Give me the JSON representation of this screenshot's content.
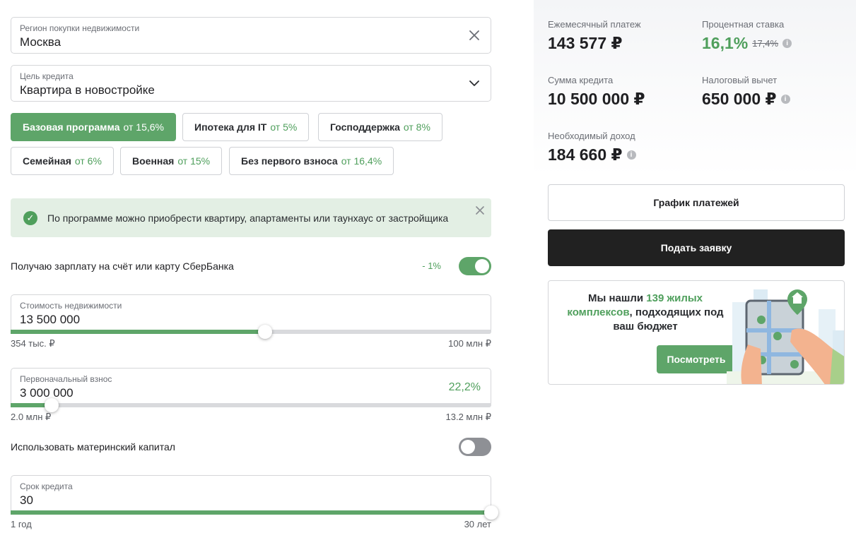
{
  "region": {
    "label": "Регион покупки недвижимости",
    "value": "Москва",
    "clear_icon": "close-icon"
  },
  "purpose": {
    "label": "Цель кредита",
    "value": "Квартира в новостройке",
    "dropdown_icon": "chevron-down-icon"
  },
  "programs": [
    {
      "name": "Базовая программа",
      "from": "от 15,6%",
      "active": true
    },
    {
      "name": "Ипотека для IT",
      "from": "от 5%",
      "active": false
    },
    {
      "name": "Господдержка",
      "from": "от 8%",
      "active": false
    },
    {
      "name": "Семейная",
      "from": "от 6%",
      "active": false
    },
    {
      "name": "Военная",
      "from": "от 15%",
      "active": false
    },
    {
      "name": "Без первого взноса",
      "from": "от 16,4%",
      "active": false
    }
  ],
  "notice": {
    "text": "По программе можно приобрести квартиру, апартаменты или таунхаус от застройщика"
  },
  "salary": {
    "label": "Получаю зарплату на счёт или карту СберБанка",
    "discount": "- 1%",
    "enabled": true
  },
  "property_cost": {
    "label": "Стоимость недвижимости",
    "value": "13 500 000",
    "min": "354 тыс. ₽",
    "max": "100 млн ₽",
    "fill_fraction": 0.53
  },
  "down_payment": {
    "label": "Первоначальный взнос",
    "value": "3 000 000",
    "percent": "22,2%",
    "min": "2.0 млн ₽",
    "max": "13.2 млн ₽",
    "fill_fraction": 0.085
  },
  "maternity": {
    "label": "Использовать материнский капитал",
    "enabled": false
  },
  "term": {
    "label": "Срок кредита",
    "value": "30",
    "min": "1 год",
    "max": "30 лет",
    "fill_fraction": 1.0
  },
  "summary": {
    "monthly_label": "Ежемесячный платеж",
    "monthly_value": "143 577 ₽",
    "rate_label": "Процентная ставка",
    "rate_value": "16,1%",
    "rate_old": "17,4%",
    "loan_label": "Сумма кредита",
    "loan_value": "10 500 000 ₽",
    "tax_label": "Налоговый вычет",
    "tax_value": "650 000 ₽",
    "income_label": "Необходимый доход",
    "income_value": "184 660 ₽",
    "info_glyph": "i"
  },
  "buttons": {
    "schedule": "График платежей",
    "apply": "Подать заявку"
  },
  "promo": {
    "text_before": "Мы нашли ",
    "text_highlight": "139 жилых комплексов",
    "text_after": ", подходящих под ваш бюджет",
    "button": "Посмотреть"
  },
  "colors": {
    "accent": "#5ea569",
    "accent_text": "#4f9f5c",
    "dark_button": "#212121",
    "notice_bg": "#e3efe4"
  }
}
